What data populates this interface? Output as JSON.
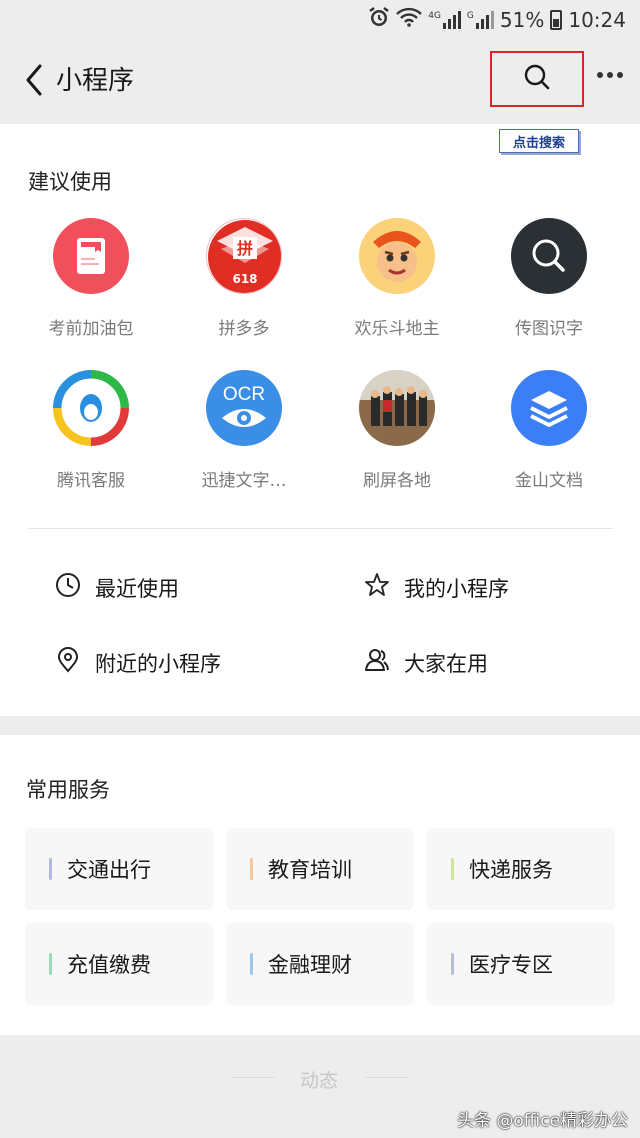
{
  "status_bar": {
    "battery": "51%",
    "time": "10:24",
    "signal_label_1": "4G",
    "signal_label_2": "G"
  },
  "nav": {
    "title": "小程序",
    "search_tooltip": "点击搜索"
  },
  "suggest": {
    "title": "建议使用",
    "apps": [
      {
        "label": "考前加油包",
        "icon": "book-icon",
        "color": "#f0505c"
      },
      {
        "label": "拼多多",
        "icon": "pinduoduo-logo-icon",
        "color": "#e02e24"
      },
      {
        "label": "欢乐斗地主",
        "icon": "cartoon-face-icon",
        "color": "#f5a623"
      },
      {
        "label": "传图识字",
        "icon": "search-icon",
        "color": "#2b3035"
      },
      {
        "label": "腾讯客服",
        "icon": "tencent-penguin-icon",
        "color": "#ffffff"
      },
      {
        "label": "迅捷文字…",
        "icon": "ocr-eye-icon",
        "color": "#3a8ee6",
        "icon_text": "OCR"
      },
      {
        "label": "刷屏各地",
        "icon": "group-photo-icon",
        "color": "#8a7d6b"
      },
      {
        "label": "金山文档",
        "icon": "stack-layers-icon",
        "color": "#3b7ef5"
      }
    ]
  },
  "quick_links": [
    {
      "label": "最近使用",
      "icon": "clock-icon"
    },
    {
      "label": "我的小程序",
      "icon": "star-icon"
    },
    {
      "label": "附近的小程序",
      "icon": "location-pin-icon"
    },
    {
      "label": "大家在用",
      "icon": "people-icon"
    }
  ],
  "services": {
    "title": "常用服务",
    "items": [
      {
        "label": "交通出行",
        "color": "#b4b8e8"
      },
      {
        "label": "教育培训",
        "color": "#f6c89a"
      },
      {
        "label": "快递服务",
        "color": "#cbe59a"
      },
      {
        "label": "充值缴费",
        "color": "#9adbb8"
      },
      {
        "label": "金融理财",
        "color": "#9ac6ea"
      },
      {
        "label": "医疗专区",
        "color": "#b4bcd6"
      }
    ]
  },
  "feed": {
    "label": "动态"
  },
  "watermark": "头条 @office精彩办公"
}
